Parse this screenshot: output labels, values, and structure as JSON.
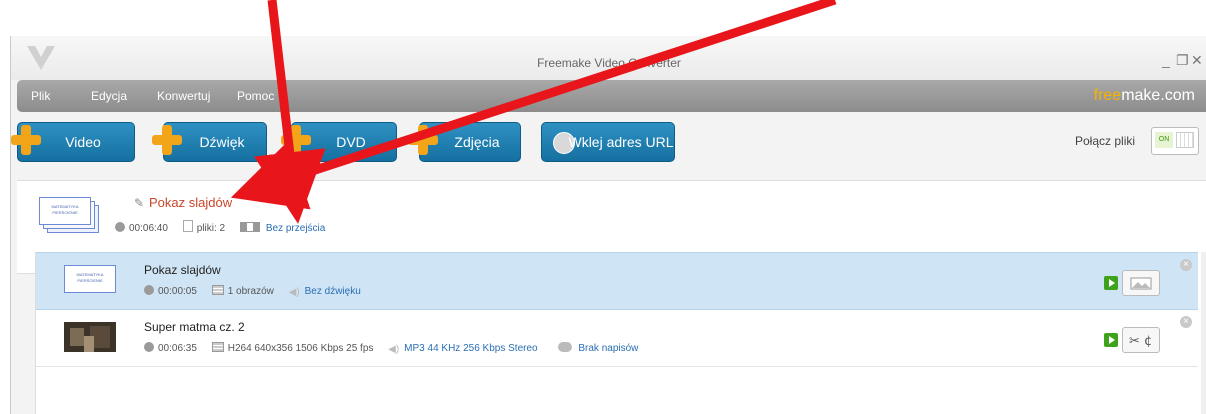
{
  "window": {
    "title": "Freemake Video Converter",
    "controls": [
      "_",
      "❐",
      "✕"
    ]
  },
  "menu": {
    "items": [
      "Plik",
      "Edycja",
      "Konwertuj",
      "Pomoc"
    ],
    "brand_a": "free",
    "brand_b": "make.com"
  },
  "toolbar": {
    "buttons": [
      "Video",
      "Dźwięk",
      "DVD",
      "Zdjęcia",
      "Wklej adres URL"
    ],
    "merge_label": "Połącz pliki",
    "toggle_on": "ON"
  },
  "group": {
    "thumb_text": "MATEMATYKA PIERŚCIENIE",
    "title": "Pokaz slajdów",
    "duration": "00:06:40",
    "files": "pliki: 2",
    "transition": "Bez przejścia"
  },
  "rows": [
    {
      "title": "Pokaz slajdów",
      "duration": "00:00:05",
      "images": "1 obrazów",
      "audio": "Bez dźwięku",
      "thumb_text": "MATEMATYKA PIERŚCIENIE"
    },
    {
      "title": "Super matma cz. 2",
      "duration": "00:06:35",
      "video": "H264 640x356 1506 Kbps 25 fps",
      "audio": "MP3 44 KHz 256 Kbps Stereo",
      "subtitles": "Brak napisów"
    }
  ],
  "colors": {
    "accent_blue": "#1e7fb2",
    "plus_orange": "#f3a51a",
    "arrow_red": "#e8161b",
    "selected_row": "#cfe4f4"
  }
}
